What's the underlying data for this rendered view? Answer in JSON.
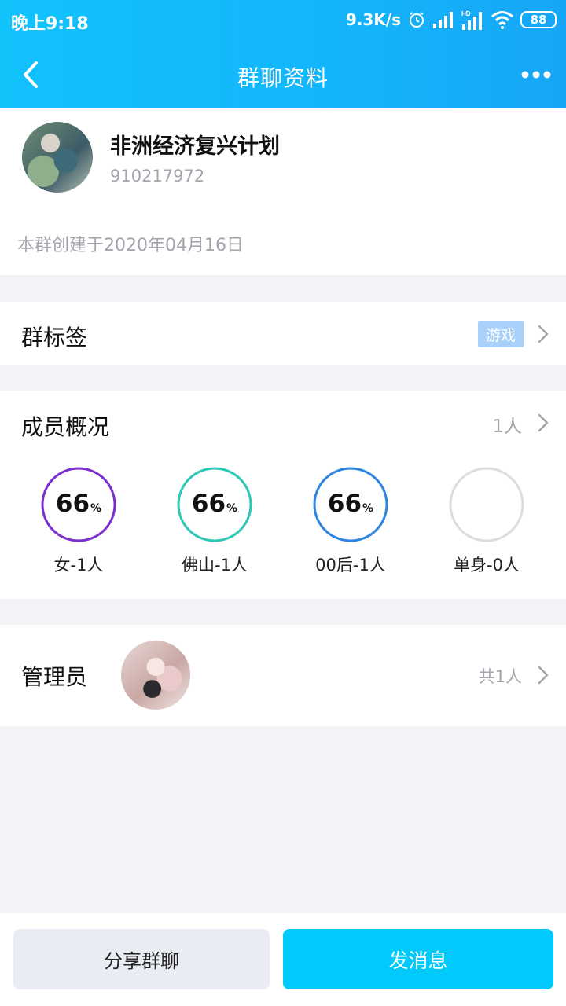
{
  "status_bar": {
    "time": "晚上9:18",
    "net_speed": "9.3K/s",
    "battery": "88",
    "icons": [
      "alarm-icon",
      "signal-icon",
      "hd-signal-icon",
      "wifi-icon",
      "battery-icon"
    ]
  },
  "header": {
    "title": "群聊资料",
    "back_icon": "chevron-left-icon",
    "more_icon": "more-dots-icon"
  },
  "group": {
    "name": "非洲经济复兴计划",
    "id": "910217972",
    "created": "本群创建于2020年04月16日"
  },
  "tags": {
    "label": "群标签",
    "chip": "游戏"
  },
  "members": {
    "label": "成员概况",
    "count": "1人",
    "stats": [
      {
        "value": "66",
        "unit": "%",
        "label": "女-1人",
        "color": "#7b2fd0",
        "fraction": 1.0
      },
      {
        "value": "66",
        "unit": "%",
        "label": "佛山-1人",
        "color": "#2ec9b6",
        "fraction": 1.0
      },
      {
        "value": "66",
        "unit": "%",
        "label": "00后-1人",
        "color": "#2f86e0",
        "fraction": 1.0
      },
      {
        "value": "",
        "unit": "",
        "label": "单身-0人",
        "color": "#dcdde0",
        "fraction": 0
      }
    ]
  },
  "admins": {
    "label": "管理员",
    "total": "共1人"
  },
  "actions": {
    "share": "分享群聊",
    "send": "发消息"
  },
  "colors": {
    "accent": "#00cafc",
    "header_start": "#12c2fb",
    "header_end": "#17a6f5",
    "muted_text": "#a3a5ad",
    "tag_chip": "#a8d0f8"
  }
}
